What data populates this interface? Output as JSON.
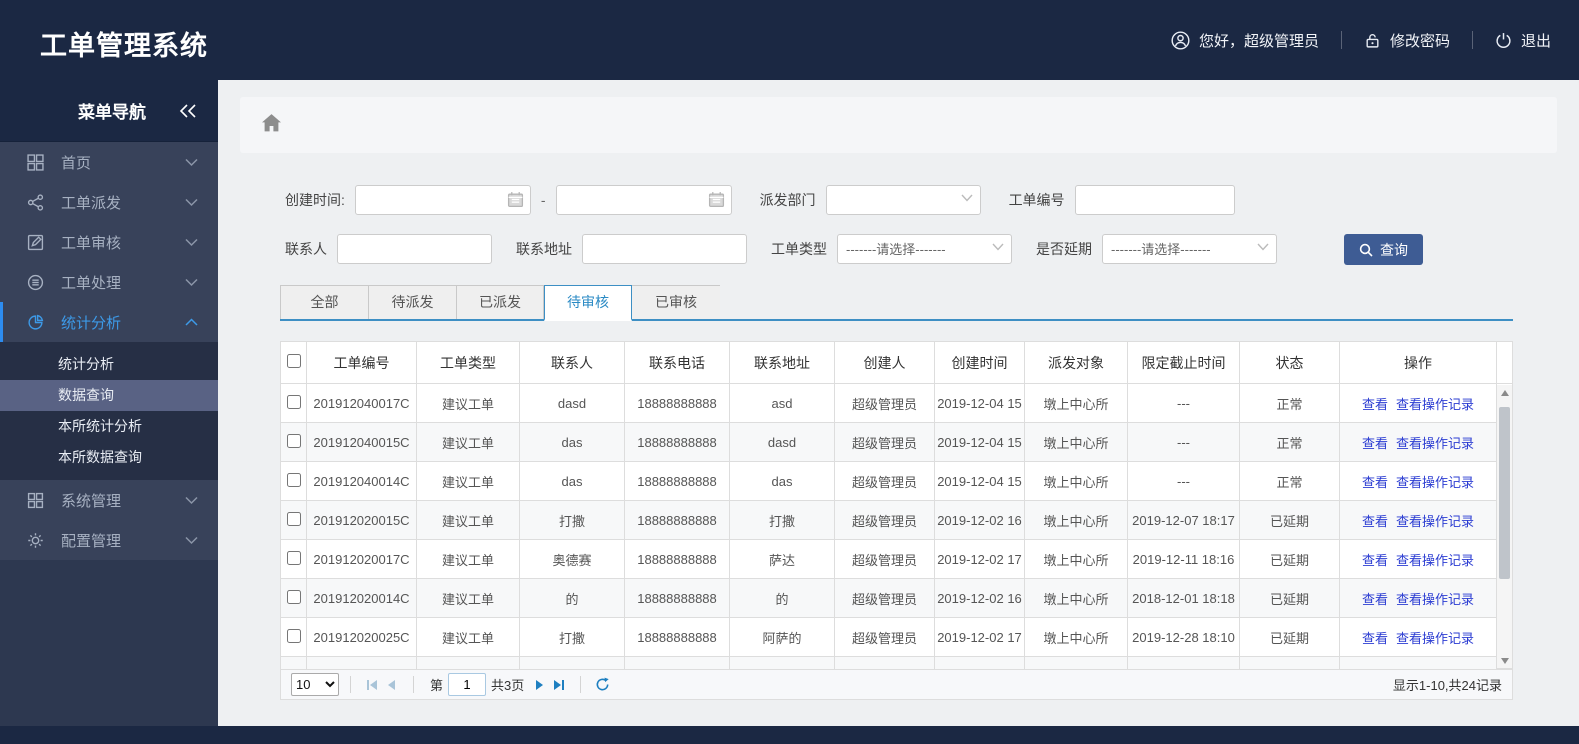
{
  "app": {
    "title": "工单管理系统"
  },
  "topbar": {
    "greeting": "您好，超级管理员",
    "change_password": "修改密码",
    "logout": "退出"
  },
  "sidebar": {
    "title": "菜单导航",
    "items": [
      {
        "label": "首页",
        "icon": "dashboard-icon"
      },
      {
        "label": "工单派发",
        "icon": "share-icon"
      },
      {
        "label": "工单审核",
        "icon": "edit-icon"
      },
      {
        "label": "工单处理",
        "icon": "process-icon"
      },
      {
        "label": "统计分析",
        "icon": "pie-chart-icon",
        "expanded": true
      },
      {
        "label": "系统管理",
        "icon": "grid-icon"
      },
      {
        "label": "配置管理",
        "icon": "gear-icon"
      }
    ],
    "submenu": [
      {
        "label": "统计分析"
      },
      {
        "label": "数据查询",
        "selected": true
      },
      {
        "label": "本所统计分析"
      },
      {
        "label": "本所数据查询"
      }
    ]
  },
  "filters": {
    "create_time_label": "创建时间:",
    "range_separator": "-",
    "create_time_start": "",
    "create_time_end": "",
    "dispatch_dept_label": "派发部门",
    "dispatch_dept_value": "",
    "order_no_label": "工单编号",
    "order_no_value": "",
    "contact_label": "联系人",
    "contact_value": "",
    "address_label": "联系地址",
    "address_value": "",
    "order_type_label": "工单类型",
    "order_type_value": "-------请选择-------",
    "delay_label": "是否延期",
    "delay_value": "-------请选择-------",
    "search_button": "查询"
  },
  "tabs": {
    "items": [
      {
        "label": "全部"
      },
      {
        "label": "待派发"
      },
      {
        "label": "已派发"
      },
      {
        "label": "待审核",
        "active": true
      },
      {
        "label": "已审核"
      }
    ]
  },
  "table": {
    "columns": [
      "工单编号",
      "工单类型",
      "联系人",
      "联系电话",
      "联系地址",
      "创建人",
      "创建时间",
      "派发对象",
      "限定截止时间",
      "状态",
      "操作"
    ],
    "row_actions": [
      "查看",
      "查看操作记录"
    ],
    "rows": [
      {
        "no": "201912040017C",
        "type": "建议工单",
        "contact": "dasd",
        "phone": "18888888888",
        "address": "asd",
        "creator": "超级管理员",
        "created": "2019-12-04 15",
        "target": "墩上中心所",
        "deadline": "---",
        "status": "正常",
        "status_style": "normal"
      },
      {
        "no": "201912040015C",
        "type": "建议工单",
        "contact": "das",
        "phone": "18888888888",
        "address": "dasd",
        "creator": "超级管理员",
        "created": "2019-12-04 15",
        "target": "墩上中心所",
        "deadline": "---",
        "status": "正常",
        "status_style": "normal"
      },
      {
        "no": "201912040014C",
        "type": "建议工单",
        "contact": "das",
        "phone": "18888888888",
        "address": "das",
        "creator": "超级管理员",
        "created": "2019-12-04 15",
        "target": "墩上中心所",
        "deadline": "---",
        "status": "正常",
        "status_style": "normal"
      },
      {
        "no": "201912020015C",
        "type": "建议工单",
        "contact": "打撒",
        "phone": "18888888888",
        "address": "打撒",
        "creator": "超级管理员",
        "created": "2019-12-02 16",
        "target": "墩上中心所",
        "deadline": "2019-12-07 18:17",
        "status": "已延期",
        "status_style": "delayed"
      },
      {
        "no": "201912020017C",
        "type": "建议工单",
        "contact": "奥德赛",
        "phone": "18888888888",
        "address": "萨达",
        "creator": "超级管理员",
        "created": "2019-12-02 17",
        "target": "墩上中心所",
        "deadline": "2019-12-11 18:16",
        "status": "已延期",
        "status_style": "delayed"
      },
      {
        "no": "201912020014C",
        "type": "建议工单",
        "contact": "的",
        "phone": "18888888888",
        "address": "的",
        "creator": "超级管理员",
        "created": "2019-12-02 16",
        "target": "墩上中心所",
        "deadline": "2018-12-01 18:18",
        "status": "已延期",
        "status_style": "delayed"
      },
      {
        "no": "201912020025C",
        "type": "建议工单",
        "contact": "打撒",
        "phone": "18888888888",
        "address": "阿萨的",
        "creator": "超级管理员",
        "created": "2019-12-02 17",
        "target": "墩上中心所",
        "deadline": "2019-12-28 18:10",
        "status": "已延期",
        "status_style": "delayed"
      }
    ]
  },
  "pagination": {
    "page_size": "10",
    "page_prefix": "第",
    "current_page": "1",
    "total_pages": "共3页",
    "summary": "显示1-10,共24记录"
  },
  "colors": {
    "navy": "#1b2843",
    "sidebar_bg": "#38425a",
    "submenu_bg": "#262f45",
    "submenu_selected": "#596284",
    "accent_blue": "#2d8cf0",
    "tab_blue": "#2a8ac4",
    "button_blue": "#3e5c94",
    "link_blue": "#2b3cd2",
    "status_red": "#e01f1f"
  }
}
